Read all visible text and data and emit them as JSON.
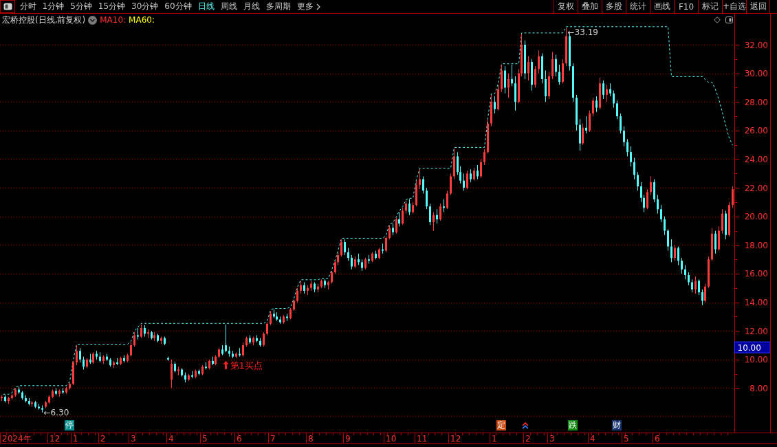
{
  "toolbar": {
    "periods": [
      {
        "label": "分时",
        "kind": "period",
        "selected": false
      },
      {
        "label": "1分钟",
        "kind": "period",
        "selected": false
      },
      {
        "label": "5分钟",
        "kind": "period",
        "selected": false
      },
      {
        "label": "15分钟",
        "kind": "period",
        "selected": false
      },
      {
        "label": "30分钟",
        "kind": "period",
        "selected": false
      },
      {
        "label": "60分钟",
        "kind": "period",
        "selected": false
      },
      {
        "label": "日线",
        "kind": "period",
        "selected": true
      },
      {
        "label": "周线",
        "kind": "period",
        "selected": false
      },
      {
        "label": "月线",
        "kind": "period",
        "selected": false
      },
      {
        "label": "多周期",
        "kind": "period",
        "selected": false
      },
      {
        "label": "更多",
        "kind": "menu",
        "selected": false
      }
    ],
    "actions": [
      "复权",
      "叠加",
      "多股",
      "统计",
      "画线",
      "F10",
      "标记",
      "+自选",
      "返回"
    ]
  },
  "chart": {
    "title": "宏桥控股(日线,前复权)",
    "indicators": [
      {
        "label": "MA10:",
        "color": "#ff3232"
      },
      {
        "label": "MA60:",
        "color": "#ffff00"
      }
    ],
    "price_tag": {
      "label": "10.00"
    },
    "extremes": [
      {
        "kind": "high",
        "text": "←33.19"
      },
      {
        "kind": "low",
        "text": "←6.30"
      }
    ],
    "signals": [
      {
        "text": "第1买点"
      }
    ],
    "events": [
      {
        "kind": "tag",
        "text": "停",
        "color": "#008c8c"
      },
      {
        "kind": "tag",
        "text": "定",
        "color": "#c84b14"
      },
      {
        "kind": "arrows"
      },
      {
        "kind": "tag",
        "text": "跌",
        "color": "#148c14"
      },
      {
        "kind": "tag",
        "text": "财",
        "color": "#14326e"
      }
    ],
    "time_axis": [
      "2024年",
      "12",
      "1",
      "2",
      "3",
      "4",
      "5",
      "6",
      "7",
      "8",
      "9",
      "10",
      "11",
      "12",
      "1",
      "2",
      "3",
      "4",
      "5",
      "6"
    ],
    "chart_data": [
      {
        "type": "candlestick",
        "grid": true,
        "ylim": [
          6,
          33.3
        ],
        "yticks": [
          {
            "value": 8,
            "label": "8.00"
          },
          {
            "value": 10,
            "label": "10.00"
          },
          {
            "value": 12,
            "label": "12.00"
          },
          {
            "value": 14,
            "label": "14.00"
          },
          {
            "value": 16,
            "label": "16.00"
          },
          {
            "value": 18,
            "label": "18.00"
          },
          {
            "value": 20,
            "label": "20.00"
          },
          {
            "value": 22,
            "label": "22.00"
          },
          {
            "value": 24,
            "label": "24.00"
          },
          {
            "value": 26,
            "label": "26.00"
          },
          {
            "value": 28,
            "label": "28.00"
          },
          {
            "value": 30,
            "label": "30.00"
          },
          {
            "value": 32,
            "label": "32.00"
          }
        ],
        "ohlc": [
          [
            7.3,
            7.5,
            7.1,
            7.4
          ],
          [
            7.4,
            7.5,
            7.0,
            7.1
          ],
          [
            7.1,
            7.4,
            6.9,
            7.3
          ],
          [
            7.3,
            7.6,
            7.2,
            7.5
          ],
          [
            7.5,
            8.0,
            7.4,
            7.9
          ],
          [
            7.9,
            8.1,
            7.6,
            7.7
          ],
          [
            7.7,
            7.8,
            7.2,
            7.3
          ],
          [
            7.3,
            7.5,
            7.0,
            7.1
          ],
          [
            7.1,
            7.3,
            6.8,
            6.9
          ],
          [
            6.9,
            7.1,
            6.7,
            7.0
          ],
          [
            7.0,
            7.1,
            6.6,
            6.7
          ],
          [
            6.7,
            6.9,
            6.5,
            6.6
          ],
          [
            6.6,
            6.8,
            6.3,
            6.5
          ],
          [
            6.7,
            7.1,
            6.6,
            7.0
          ],
          [
            7.0,
            7.5,
            6.9,
            7.4
          ],
          [
            7.4,
            7.9,
            7.3,
            7.8
          ],
          [
            7.8,
            8.0,
            7.5,
            7.6
          ],
          [
            7.6,
            7.9,
            7.4,
            7.8
          ],
          [
            7.8,
            8.0,
            7.6,
            7.7
          ],
          [
            7.7,
            8.1,
            7.6,
            8.0
          ],
          [
            8.0,
            8.4,
            7.9,
            8.3
          ],
          [
            8.3,
            9.9,
            8.2,
            9.8
          ],
          [
            9.8,
            11.0,
            9.6,
            10.6
          ],
          [
            10.6,
            10.8,
            9.8,
            10.0
          ],
          [
            10.0,
            10.2,
            9.3,
            9.5
          ],
          [
            9.5,
            10.1,
            9.4,
            10.0
          ],
          [
            10.0,
            10.4,
            9.7,
            9.8
          ],
          [
            9.8,
            10.5,
            9.7,
            10.4
          ],
          [
            10.4,
            10.6,
            10.0,
            10.2
          ],
          [
            10.2,
            10.5,
            9.8,
            9.9
          ],
          [
            9.9,
            10.3,
            9.7,
            10.2
          ],
          [
            10.2,
            10.4,
            9.9,
            10.0
          ],
          [
            10.0,
            10.1,
            9.5,
            9.6
          ],
          [
            9.6,
            9.9,
            9.4,
            9.8
          ],
          [
            9.8,
            10.1,
            9.6,
            9.7
          ],
          [
            9.7,
            10.2,
            9.6,
            10.1
          ],
          [
            10.1,
            10.3,
            9.8,
            9.9
          ],
          [
            9.9,
            10.4,
            9.8,
            10.3
          ],
          [
            10.3,
            11.2,
            10.2,
            11.0
          ],
          [
            11.0,
            11.9,
            10.9,
            11.7
          ],
          [
            11.7,
            12.2,
            11.4,
            11.6
          ],
          [
            11.6,
            12.45,
            11.5,
            12.2
          ],
          [
            12.2,
            12.4,
            11.6,
            11.8
          ],
          [
            11.8,
            12.1,
            11.5,
            11.9
          ],
          [
            11.9,
            12.0,
            11.4,
            11.5
          ],
          [
            11.5,
            11.9,
            11.3,
            11.7
          ],
          [
            11.7,
            11.8,
            11.2,
            11.3
          ],
          [
            11.3,
            11.6,
            11.1,
            11.5
          ],
          [
            11.5,
            11.6,
            11.0,
            11.1
          ],
          [
            10.1,
            10.2,
            9.9,
            10.0
          ],
          [
            8.6,
            10.0,
            8.0,
            9.7
          ],
          [
            9.7,
            9.8,
            9.1,
            9.2
          ],
          [
            9.2,
            9.5,
            8.9,
            9.3
          ],
          [
            9.3,
            9.4,
            8.8,
            8.9
          ],
          [
            8.9,
            9.1,
            8.4,
            8.6
          ],
          [
            8.6,
            9.0,
            8.5,
            8.9
          ],
          [
            8.9,
            9.2,
            8.7,
            8.8
          ],
          [
            8.8,
            9.3,
            8.7,
            9.2
          ],
          [
            9.2,
            9.3,
            8.9,
            9.0
          ],
          [
            9.0,
            9.6,
            8.9,
            9.5
          ],
          [
            9.5,
            9.8,
            9.3,
            9.4
          ],
          [
            9.4,
            10.0,
            9.3,
            9.9
          ],
          [
            9.9,
            10.2,
            9.6,
            9.7
          ],
          [
            9.7,
            10.3,
            9.6,
            10.2
          ],
          [
            10.2,
            10.8,
            10.1,
            10.7
          ],
          [
            10.7,
            11.0,
            10.3,
            10.4
          ],
          [
            11.0,
            12.45,
            10.5,
            10.6
          ],
          [
            10.6,
            10.9,
            10.2,
            10.4
          ],
          [
            10.4,
            10.6,
            10.1,
            10.2
          ],
          [
            10.2,
            10.5,
            10.1,
            10.4
          ],
          [
            10.4,
            10.8,
            10.2,
            10.3
          ],
          [
            10.3,
            11.2,
            10.2,
            11.0
          ],
          [
            11.0,
            11.6,
            10.9,
            11.5
          ],
          [
            11.5,
            11.7,
            11.1,
            11.2
          ],
          [
            11.2,
            11.6,
            11.0,
            11.5
          ],
          [
            11.5,
            11.7,
            11.2,
            11.3
          ],
          [
            11.3,
            11.5,
            10.9,
            11.0
          ],
          [
            11.0,
            11.9,
            10.9,
            11.8
          ],
          [
            11.8,
            12.6,
            11.7,
            12.5
          ],
          [
            12.5,
            13.4,
            12.4,
            13.2
          ],
          [
            13.2,
            13.5,
            12.9,
            13.0
          ],
          [
            13.0,
            13.3,
            12.7,
            12.8
          ],
          [
            12.8,
            13.0,
            12.5,
            12.6
          ],
          [
            12.6,
            13.1,
            12.5,
            13.0
          ],
          [
            13.0,
            13.2,
            12.7,
            12.9
          ],
          [
            12.9,
            13.6,
            12.8,
            13.5
          ],
          [
            13.5,
            14.2,
            13.4,
            14.1
          ],
          [
            14.1,
            15.0,
            14.0,
            14.8
          ],
          [
            14.8,
            15.5,
            14.6,
            15.2
          ],
          [
            15.2,
            15.4,
            14.6,
            14.8
          ],
          [
            14.8,
            15.2,
            14.5,
            15.0
          ],
          [
            15.0,
            15.5,
            14.8,
            15.3
          ],
          [
            15.3,
            15.4,
            14.7,
            14.9
          ],
          [
            14.9,
            15.3,
            14.7,
            15.1
          ],
          [
            15.1,
            15.6,
            15.0,
            15.5
          ],
          [
            15.5,
            15.6,
            15.0,
            15.2
          ],
          [
            15.2,
            15.5,
            14.9,
            15.4
          ],
          [
            15.4,
            16.2,
            15.3,
            16.1
          ],
          [
            16.1,
            16.9,
            16.0,
            16.8
          ],
          [
            16.8,
            17.5,
            16.6,
            17.3
          ],
          [
            17.3,
            18.4,
            17.2,
            18.2
          ],
          [
            18.2,
            18.4,
            17.3,
            17.5
          ],
          [
            17.5,
            17.8,
            16.9,
            17.1
          ],
          [
            17.1,
            17.3,
            16.3,
            16.5
          ],
          [
            16.5,
            17.2,
            16.4,
            17.0
          ],
          [
            17.0,
            17.4,
            16.6,
            16.8
          ],
          [
            16.8,
            17.0,
            16.2,
            16.4
          ],
          [
            16.4,
            17.1,
            16.3,
            17.0
          ],
          [
            17.0,
            17.3,
            16.7,
            16.9
          ],
          [
            16.9,
            17.5,
            16.8,
            17.4
          ],
          [
            17.4,
            17.6,
            17.0,
            17.1
          ],
          [
            17.1,
            17.8,
            17.0,
            17.7
          ],
          [
            17.7,
            18.1,
            17.4,
            17.6
          ],
          [
            17.6,
            18.6,
            17.5,
            18.5
          ],
          [
            18.5,
            19.4,
            18.4,
            19.2
          ],
          [
            19.2,
            19.5,
            18.7,
            18.9
          ],
          [
            18.9,
            19.9,
            18.8,
            19.8
          ],
          [
            19.8,
            20.3,
            19.3,
            19.5
          ],
          [
            19.5,
            20.6,
            19.4,
            20.4
          ],
          [
            20.4,
            21.1,
            20.2,
            20.9
          ],
          [
            20.9,
            21.2,
            20.1,
            20.3
          ],
          [
            20.3,
            21.0,
            20.2,
            20.8
          ],
          [
            20.8,
            22.5,
            20.7,
            22.2
          ],
          [
            22.2,
            23.3,
            21.9,
            22.6
          ],
          [
            22.6,
            22.8,
            21.6,
            21.8
          ],
          [
            21.8,
            22.0,
            20.5,
            20.7
          ],
          [
            20.7,
            20.9,
            19.4,
            19.6
          ],
          [
            19.6,
            20.3,
            19.0,
            20.1
          ],
          [
            20.1,
            20.5,
            19.5,
            19.8
          ],
          [
            19.8,
            20.9,
            19.7,
            20.7
          ],
          [
            20.7,
            21.2,
            20.3,
            20.6
          ],
          [
            20.6,
            21.8,
            20.5,
            21.6
          ],
          [
            21.6,
            23.0,
            21.5,
            22.8
          ],
          [
            22.8,
            24.75,
            22.6,
            24.2
          ],
          [
            24.2,
            24.5,
            22.9,
            23.1
          ],
          [
            23.1,
            23.5,
            22.3,
            22.5
          ],
          [
            22.5,
            23.0,
            21.8,
            22.0
          ],
          [
            22.0,
            23.2,
            21.9,
            23.0
          ],
          [
            23.0,
            23.3,
            22.4,
            22.6
          ],
          [
            22.6,
            23.4,
            22.5,
            23.2
          ],
          [
            23.2,
            23.6,
            22.6,
            22.8
          ],
          [
            22.8,
            24.0,
            22.7,
            23.8
          ],
          [
            23.8,
            24.7,
            23.6,
            24.5
          ],
          [
            24.5,
            26.8,
            24.4,
            26.5
          ],
          [
            26.5,
            28.5,
            26.3,
            28.0
          ],
          [
            28.0,
            28.4,
            27.2,
            27.5
          ],
          [
            27.5,
            29.2,
            27.4,
            28.9
          ],
          [
            28.9,
            30.6,
            28.7,
            30.2
          ],
          [
            30.2,
            30.5,
            28.6,
            29.0
          ],
          [
            29.0,
            30.0,
            28.3,
            29.6
          ],
          [
            29.6,
            30.6,
            29.1,
            29.3
          ],
          [
            29.3,
            29.8,
            27.4,
            28.0
          ],
          [
            28.0,
            30.3,
            27.9,
            30.0
          ],
          [
            30.0,
            32.75,
            29.8,
            32.0
          ],
          [
            32.0,
            32.3,
            29.6,
            30.0
          ],
          [
            30.0,
            31.2,
            29.5,
            30.8
          ],
          [
            30.8,
            31.0,
            28.8,
            29.2
          ],
          [
            29.2,
            30.5,
            29.0,
            30.3
          ],
          [
            30.3,
            31.6,
            30.0,
            31.2
          ],
          [
            31.2,
            31.4,
            29.3,
            29.6
          ],
          [
            29.6,
            30.2,
            28.0,
            28.4
          ],
          [
            28.4,
            30.1,
            28.2,
            29.8
          ],
          [
            29.8,
            31.5,
            29.6,
            31.0
          ],
          [
            31.0,
            31.3,
            29.8,
            30.1
          ],
          [
            30.1,
            30.6,
            29.2,
            29.4
          ],
          [
            29.4,
            31.0,
            29.3,
            30.7
          ],
          [
            30.7,
            33.19,
            30.5,
            32.6
          ],
          [
            32.6,
            32.8,
            30.2,
            30.5
          ],
          [
            30.5,
            30.7,
            28.0,
            28.3
          ],
          [
            28.3,
            28.5,
            26.0,
            26.4
          ],
          [
            26.4,
            26.8,
            24.6,
            25.1
          ],
          [
            25.1,
            26.5,
            25.0,
            26.2
          ],
          [
            26.2,
            27.0,
            25.8,
            26.0
          ],
          [
            26.0,
            27.4,
            25.9,
            27.2
          ],
          [
            27.2,
            28.3,
            27.0,
            28.1
          ],
          [
            28.1,
            28.4,
            27.3,
            27.6
          ],
          [
            27.6,
            29.7,
            27.5,
            29.3
          ],
          [
            29.3,
            29.5,
            28.2,
            28.5
          ],
          [
            28.5,
            29.2,
            28.0,
            28.9
          ],
          [
            28.9,
            29.3,
            28.4,
            28.6
          ],
          [
            28.6,
            28.8,
            27.6,
            27.9
          ],
          [
            27.9,
            28.1,
            26.8,
            27.0
          ],
          [
            27.0,
            27.2,
            25.8,
            26.0
          ],
          [
            26.0,
            26.3,
            24.9,
            25.2
          ],
          [
            25.2,
            25.4,
            24.2,
            24.5
          ],
          [
            24.5,
            24.9,
            23.5,
            23.8
          ],
          [
            23.8,
            24.1,
            22.6,
            22.9
          ],
          [
            22.9,
            23.1,
            21.8,
            22.1
          ],
          [
            22.1,
            22.4,
            21.0,
            21.3
          ],
          [
            21.3,
            21.5,
            20.3,
            20.6
          ],
          [
            20.6,
            21.9,
            20.5,
            21.7
          ],
          [
            21.7,
            22.8,
            21.5,
            22.4
          ],
          [
            22.4,
            22.6,
            21.0,
            21.2
          ],
          [
            21.2,
            21.5,
            20.2,
            20.5
          ],
          [
            20.5,
            20.8,
            19.6,
            19.8
          ],
          [
            19.8,
            20.0,
            18.7,
            19.0
          ],
          [
            19.0,
            19.1,
            17.6,
            17.9
          ],
          [
            17.9,
            18.4,
            16.8,
            17.1
          ],
          [
            17.1,
            18.0,
            16.9,
            17.8
          ],
          [
            17.8,
            17.9,
            16.6,
            16.9
          ],
          [
            16.9,
            17.1,
            16.0,
            16.3
          ],
          [
            16.3,
            16.6,
            15.6,
            15.9
          ],
          [
            15.9,
            16.1,
            15.2,
            15.4
          ],
          [
            15.4,
            15.6,
            14.7,
            14.9
          ],
          [
            14.9,
            15.8,
            14.6,
            15.5
          ],
          [
            15.5,
            15.6,
            14.5,
            14.7
          ],
          [
            14.7,
            14.9,
            13.8,
            14.1
          ],
          [
            14.1,
            15.3,
            14.0,
            15.1
          ],
          [
            15.1,
            17.2,
            15.0,
            17.0
          ],
          [
            17.0,
            19.2,
            16.9,
            18.8
          ],
          [
            18.8,
            19.0,
            17.4,
            17.7
          ],
          [
            17.7,
            19.3,
            17.6,
            19.0
          ],
          [
            19.0,
            20.5,
            18.8,
            20.2
          ],
          [
            20.2,
            20.4,
            18.4,
            18.7
          ],
          [
            18.7,
            21.0,
            18.6,
            20.8
          ],
          [
            20.8,
            22.1,
            20.6,
            21.9
          ]
        ],
        "series": [
          {
            "type": "line",
            "color": "#54fcfc",
            "line_style": "dashed",
            "values": [
              7.5,
              7.5,
              7.5,
              7.6,
              8.0,
              8.1,
              8.1,
              8.1,
              8.1,
              8.1,
              8.1,
              8.1,
              8.1,
              8.1,
              8.1,
              8.1,
              8.1,
              8.1,
              8.1,
              8.1,
              8.4,
              9.9,
              11,
              11,
              11,
              11,
              11,
              11,
              11,
              11,
              11,
              11,
              11,
              11,
              11,
              11,
              11,
              11,
              11.2,
              11.9,
              12.2,
              12.45,
              12.45,
              12.45,
              12.45,
              12.45,
              12.45,
              12.45,
              12.45,
              12.45,
              12.45,
              12.45,
              12.45,
              12.45,
              12.45,
              12.45,
              12.45,
              12.45,
              12.45,
              12.45,
              12.45,
              12.45,
              12.45,
              12.45,
              12.45,
              12.45,
              12.45,
              12.45,
              12.45,
              12.45,
              12.45,
              12.45,
              12.45,
              12.45,
              12.45,
              12.45,
              12.45,
              12.45,
              12.6,
              13.4,
              13.5,
              13.5,
              13.5,
              13.5,
              13.5,
              13.6,
              14.2,
              15.0,
              15.5,
              15.5,
              15.5,
              15.5,
              15.5,
              15.5,
              15.6,
              15.6,
              15.6,
              16.2,
              16.9,
              17.5,
              18.4,
              18.4,
              18.4,
              18.4,
              18.4,
              18.4,
              18.4,
              18.4,
              18.4,
              18.4,
              18.4,
              18.4,
              18.4,
              18.6,
              19.4,
              19.5,
              19.9,
              20.3,
              20.6,
              21.1,
              21.2,
              21.2,
              22.5,
              23.3,
              23.3,
              23.3,
              23.3,
              23.3,
              23.3,
              23.3,
              23.3,
              23.3,
              23.3,
              24.75,
              24.75,
              24.75,
              24.75,
              24.75,
              24.75,
              24.75,
              24.75,
              24.75,
              24.75,
              26.8,
              28.5,
              28.5,
              29.2,
              30.6,
              30.6,
              30.6,
              30.6,
              30.6,
              30.6,
              32.75,
              32.75,
              32.75,
              32.75,
              32.75,
              32.75,
              32.75,
              32.75,
              32.75,
              32.75,
              32.75,
              32.75,
              32.75,
              33.19,
              33.19,
              33.19,
              33.19,
              33.19,
              33.19,
              33.19,
              33.19,
              33.19,
              33.19,
              33.19,
              33.19,
              33.19,
              33.19,
              33.19,
              33.19,
              33.19,
              33.19,
              33.19,
              33.19,
              33.19,
              33.19,
              33.19,
              33.19,
              33.19,
              33.19,
              33.19,
              33.19,
              33.19,
              33.19,
              33.19,
              29.7,
              29.7,
              29.7,
              29.7,
              29.7,
              29.7,
              29.7,
              29.7,
              29.7,
              29.7,
              29.5,
              29.3,
              29.3,
              28.8,
              28.1,
              27.2,
              26.3,
              25.4,
              24.9
            ]
          }
        ]
      }
    ]
  }
}
